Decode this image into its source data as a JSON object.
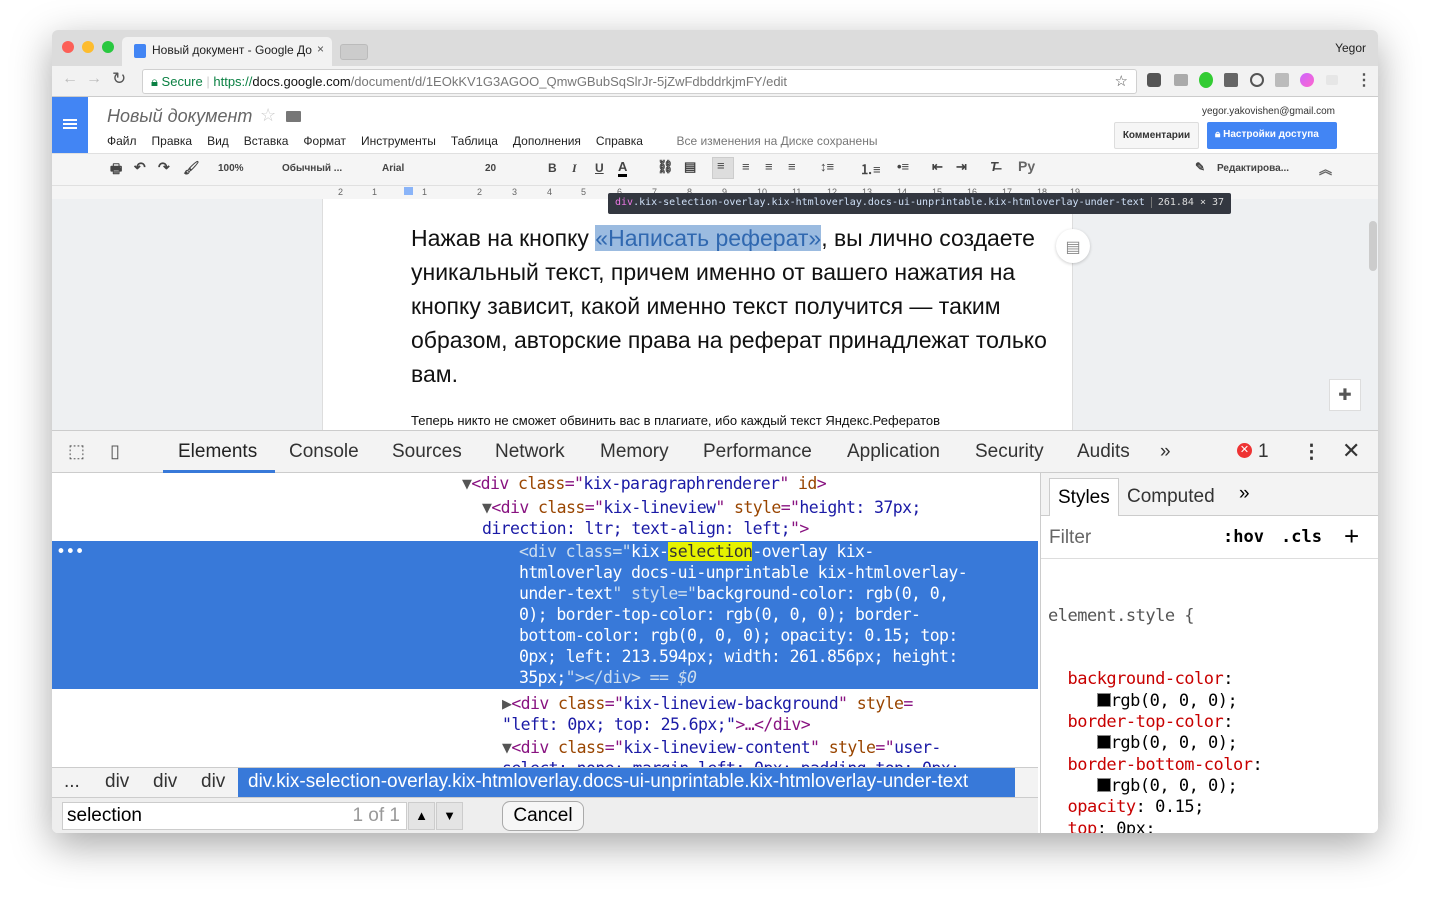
{
  "browser": {
    "tab_title": "Новый документ - Google До",
    "profile": "Yegor",
    "secure_label": "Secure",
    "url_scheme": "https://",
    "url_host": "docs.google.com",
    "url_path": "/document/d/1EOkKV1G3AGOO_QmwGBubSqSlrJr-5jZwFdbddrkjmFY/edit"
  },
  "docs": {
    "title": "Новый документ",
    "menu": [
      "Файл",
      "Правка",
      "Вид",
      "Вставка",
      "Формат",
      "Инструменты",
      "Таблица",
      "Дополнения",
      "Справка"
    ],
    "save_status": "Все изменения на Диске сохранены",
    "account": "yegor.yakovishen@gmail.com",
    "comments_button": "Комментарии",
    "share_button": "Настройки доступа",
    "toolbar": {
      "zoom": "100%",
      "style": "Обычный ...",
      "font": "Arial",
      "size": "20",
      "bold": "B",
      "italic": "I",
      "underline": "U",
      "color": "A",
      "input_tools": "Ру",
      "mode": "Редактирова..."
    },
    "ruler": [
      "2",
      "1",
      "1",
      "2",
      "3",
      "4",
      "5",
      "6",
      "7",
      "8",
      "9",
      "10",
      "11",
      "12",
      "13",
      "14",
      "15",
      "16",
      "17",
      "18",
      "19"
    ],
    "paragraph_before": "Нажав на кнопку ",
    "paragraph_highlight": "«Написать реферат»",
    "paragraph_after": ", вы лично создаете уникальный текст, причем именно от вашего нажатия на кнопку зависит, какой именно текст получится — таким образом, авторские права на реферат принадлежат только вам.",
    "next_line": "Теперь никто не сможет обвинить вас в плагиате, ибо каждый текст Яндекс.Рефератов"
  },
  "tooltip": {
    "tag": "div",
    "selector": ".kix-selection-overlay.kix-htmloverlay.docs-ui-unprintable.kix-htmloverlay-under-text",
    "size": "261.84 × 37"
  },
  "devtools": {
    "tabs": [
      "Elements",
      "Console",
      "Sources",
      "Network",
      "Memory",
      "Performance",
      "Application",
      "Security",
      "Audits"
    ],
    "active_tab": "Elements",
    "error_count": "1",
    "breadcrumbs": [
      "...",
      "div",
      "div",
      "div",
      "div.kix-selection-overlay.kix-htmloverlay.docs-ui-unprintable.kix-htmloverlay-under-text"
    ],
    "search": {
      "value": "selection",
      "count": "1 of 1",
      "cancel": "Cancel"
    },
    "styles": {
      "tabs": [
        "Styles",
        "Computed"
      ],
      "filter_placeholder": "Filter",
      "hov": ":hov",
      "cls": ".cls",
      "selector": "element.style {",
      "props": [
        {
          "name": "background-color",
          "value": "rgb(0, 0, 0);",
          "swatch": "#000000"
        },
        {
          "name": "border-top-color",
          "value": "rgb(0, 0, 0);",
          "swatch": "#000000"
        },
        {
          "name": "border-bottom-color",
          "value": "rgb(0, 0, 0);",
          "swatch": "#000000"
        },
        {
          "name": "opacity",
          "value": "0.15;"
        },
        {
          "name": "top",
          "value": "0px;"
        },
        {
          "name": "left",
          "value": "213.594px;"
        },
        {
          "name": "width",
          "value": "261.856px;"
        },
        {
          "name": "height",
          "value": "35px;"
        }
      ]
    }
  },
  "colors": {
    "accent": "#4285f4",
    "selection": "#3879d9",
    "highlight": "#9bbbe0"
  }
}
